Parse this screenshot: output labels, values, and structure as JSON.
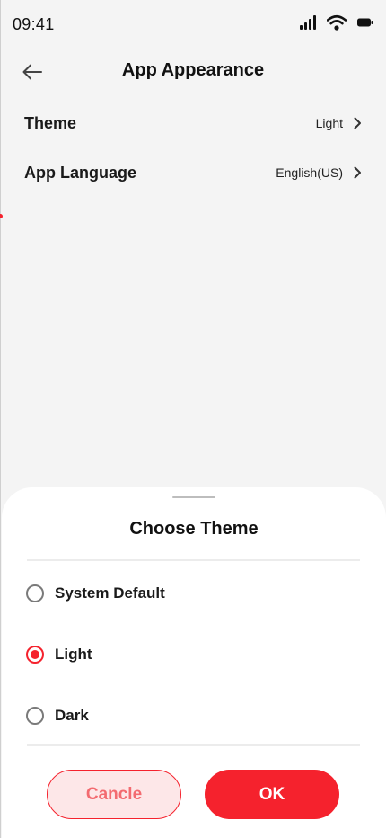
{
  "status_bar": {
    "time": "09:41"
  },
  "header": {
    "title": "App Appearance"
  },
  "settings": [
    {
      "label": "Theme",
      "value": "Light"
    },
    {
      "label": "App Language",
      "value": "English(US)"
    }
  ],
  "sheet": {
    "title": "Choose Theme",
    "options": [
      {
        "label": "System Default",
        "selected": false
      },
      {
        "label": "Light",
        "selected": true
      },
      {
        "label": "Dark",
        "selected": false
      }
    ],
    "cancel_label": "Cancle",
    "ok_label": "OK"
  },
  "colors": {
    "accent": "#f5222d",
    "cancel_bg": "#fde7e8",
    "background": "#f4f4f4",
    "sheet_bg": "#ffffff"
  },
  "icons": {
    "back": "arrow-left-icon",
    "chevron": "chevron-right-icon",
    "signal": "signal-icon",
    "wifi": "wifi-icon",
    "battery": "battery-icon"
  }
}
